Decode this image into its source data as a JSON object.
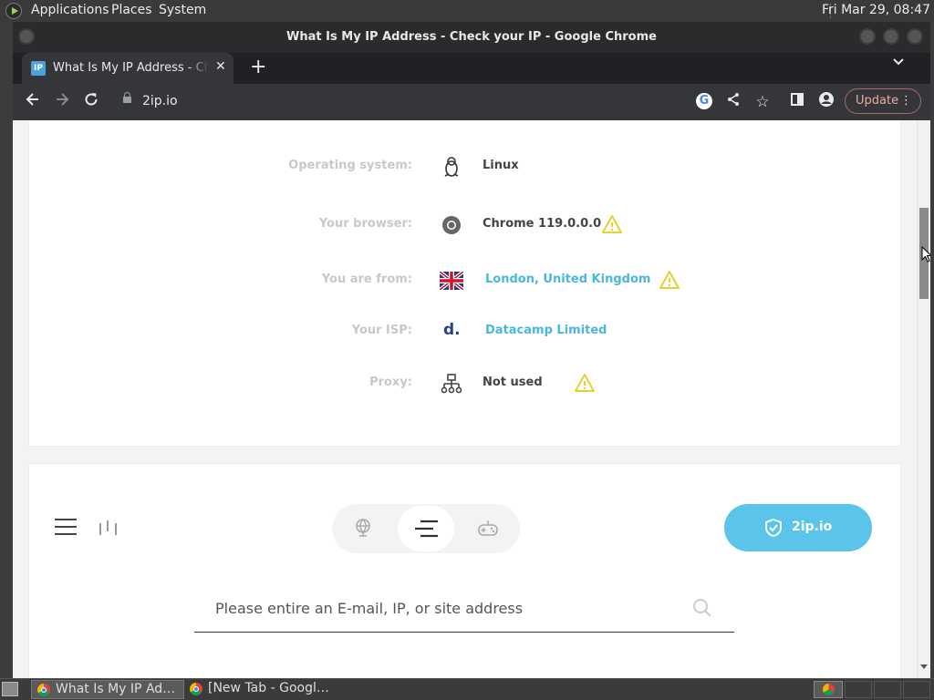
{
  "system_panel": {
    "menus": [
      "Applications",
      "Places",
      "System"
    ],
    "clock": "Fri Mar 29, 08:47"
  },
  "window": {
    "title": "What Is My IP Address - Check your IP - Google Chrome"
  },
  "tab": {
    "favicon_text": "IP",
    "title": "What Is My IP Address - Check your IP"
  },
  "toolbar": {
    "url": "2ip.io",
    "update_label": "Update"
  },
  "info": {
    "rows": [
      {
        "label": "Operating system:",
        "value": "Linux",
        "icon": "linux-icon",
        "warning": false
      },
      {
        "label": "Your browser:",
        "value": "Chrome 119.0.0.0",
        "icon": "chrome-icon",
        "warning": true
      },
      {
        "label": "You are from:",
        "value": "London, United Kingdom",
        "icon": "uk-flag-icon",
        "warning": true
      },
      {
        "label": "Your ISP:",
        "value": "Datacamp Limited",
        "icon": "isp-logo-icon",
        "icon_text": "d.",
        "warning": false
      },
      {
        "label": "Proxy:",
        "value": "Not used",
        "icon": "network-icon",
        "warning": true
      }
    ]
  },
  "nav": {
    "brand_label": "2ip.io",
    "search_placeholder": "Please entire an E-mail, IP, or site address"
  },
  "taskbar": {
    "tasks": [
      "What Is My IP Address - Check your IP - Google Chrome",
      "[New Tab - Google Chrome]"
    ]
  },
  "colors": {
    "accent": "#5bc4ea",
    "link": "#4ab7e1",
    "warning": "#e2d232",
    "update_text": "#f0a9a3"
  }
}
